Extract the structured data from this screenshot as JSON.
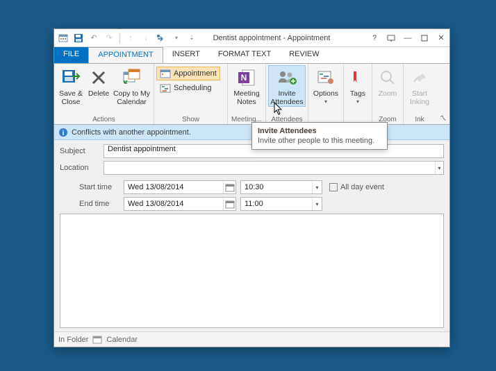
{
  "window": {
    "title": "Dentist appointment - Appointment"
  },
  "tabs": {
    "file": "FILE",
    "appointment": "APPOINTMENT",
    "insert": "INSERT",
    "format_text": "FORMAT TEXT",
    "review": "REVIEW"
  },
  "ribbon": {
    "actions": {
      "label": "Actions",
      "save_close": "Save & Close",
      "delete": "Delete",
      "copy_cal": "Copy to My Calendar"
    },
    "show": {
      "label": "Show",
      "appointment": "Appointment",
      "scheduling": "Scheduling"
    },
    "meeting": {
      "label": "Meeting...",
      "notes": "Meeting Notes"
    },
    "attendees": {
      "label": "Attendees",
      "invite": "Invite Attendees"
    },
    "options": {
      "label": "Options"
    },
    "tags": {
      "label": "Tags"
    },
    "zoom": {
      "label": "Zoom",
      "btn": "Zoom"
    },
    "ink": {
      "label": "Ink",
      "btn": "Start Inking"
    }
  },
  "infobar": {
    "text": "Conflicts with another appointment."
  },
  "form": {
    "subject_label": "Subject",
    "subject_value": "Dentist appointment",
    "location_label": "Location",
    "location_value": "",
    "start_label": "Start time",
    "end_label": "End time",
    "start_date": "Wed 13/08/2014",
    "start_time": "10:30",
    "end_date": "Wed 13/08/2014",
    "end_time": "11:00",
    "allday_label": "All day event"
  },
  "tooltip": {
    "title": "Invite Attendees",
    "body": "Invite other people to this meeting."
  },
  "status": {
    "infolder_label": "In Folder",
    "folder": "Calendar"
  }
}
